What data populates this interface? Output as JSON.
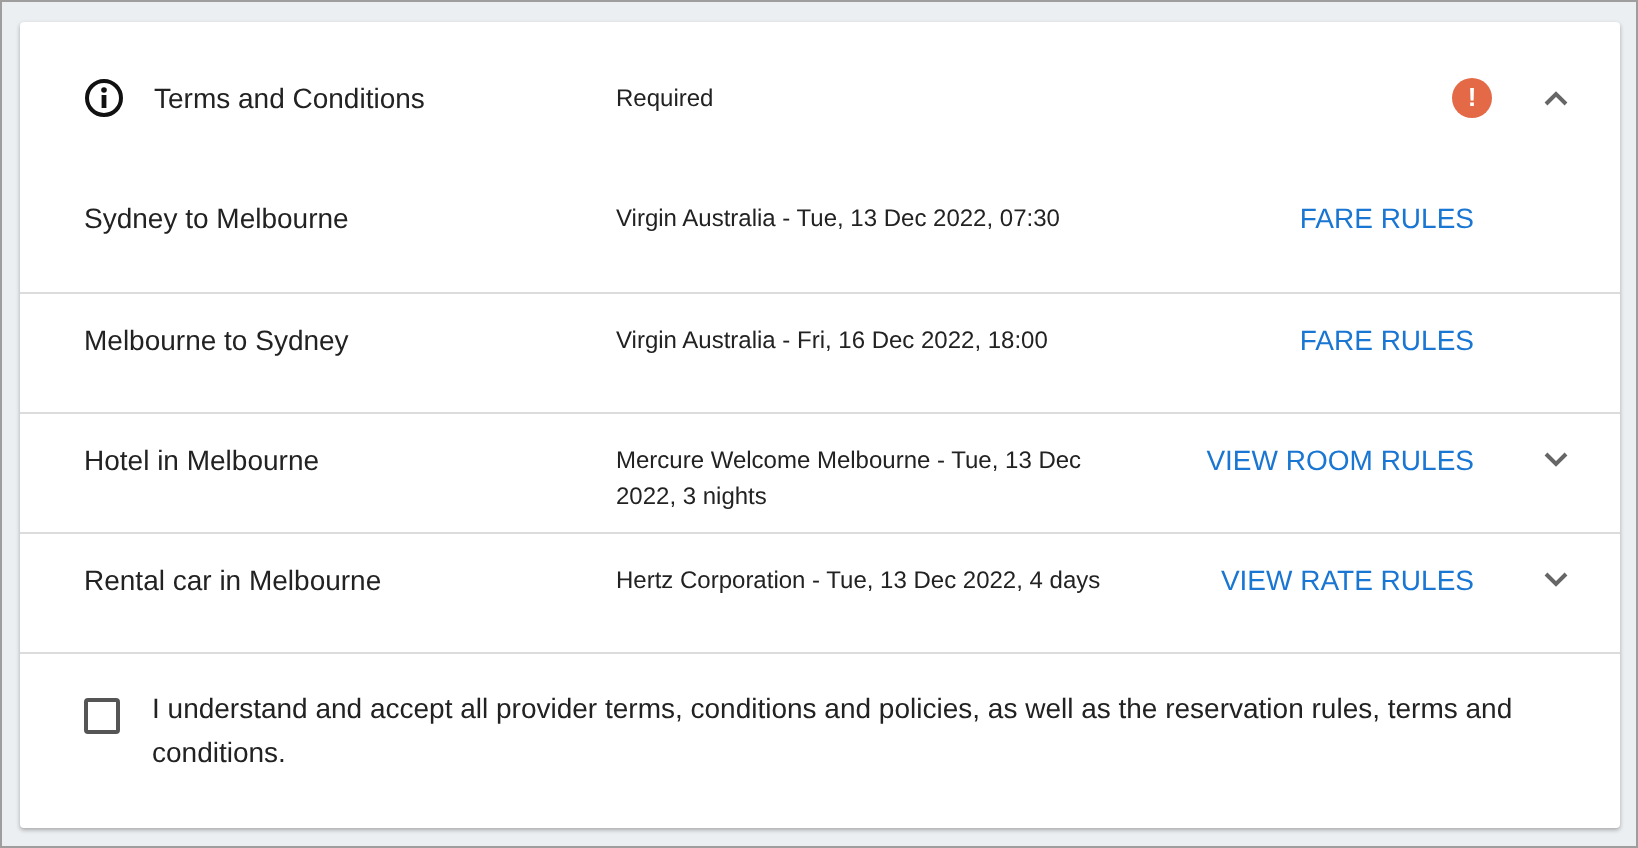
{
  "header": {
    "title": "Terms and Conditions",
    "status": "Required",
    "alert": "!",
    "expanded": true
  },
  "items": [
    {
      "name": "Sydney to Melbourne",
      "details": "Virgin Australia - Tue, 13 Dec 2022, 07:30",
      "link": "FARE RULES"
    },
    {
      "name": "Melbourne to Sydney",
      "details": "Virgin Australia - Fri, 16 Dec 2022, 18:00",
      "link": "FARE RULES"
    },
    {
      "name": "Hotel in Melbourne",
      "details": "Mercure Welcome Melbourne - Tue, 13 Dec 2022, 3 nights",
      "link": "VIEW ROOM RULES",
      "expanded": false
    },
    {
      "name": "Rental car in Melbourne",
      "details": "Hertz Corporation - Tue, 13 Dec 2022, 4 days",
      "link": "VIEW RATE RULES",
      "expanded": false
    }
  ],
  "agreement": {
    "label": "I understand and accept all provider terms, conditions and policies, as well as the reservation rules, terms and conditions.",
    "checked": false
  }
}
